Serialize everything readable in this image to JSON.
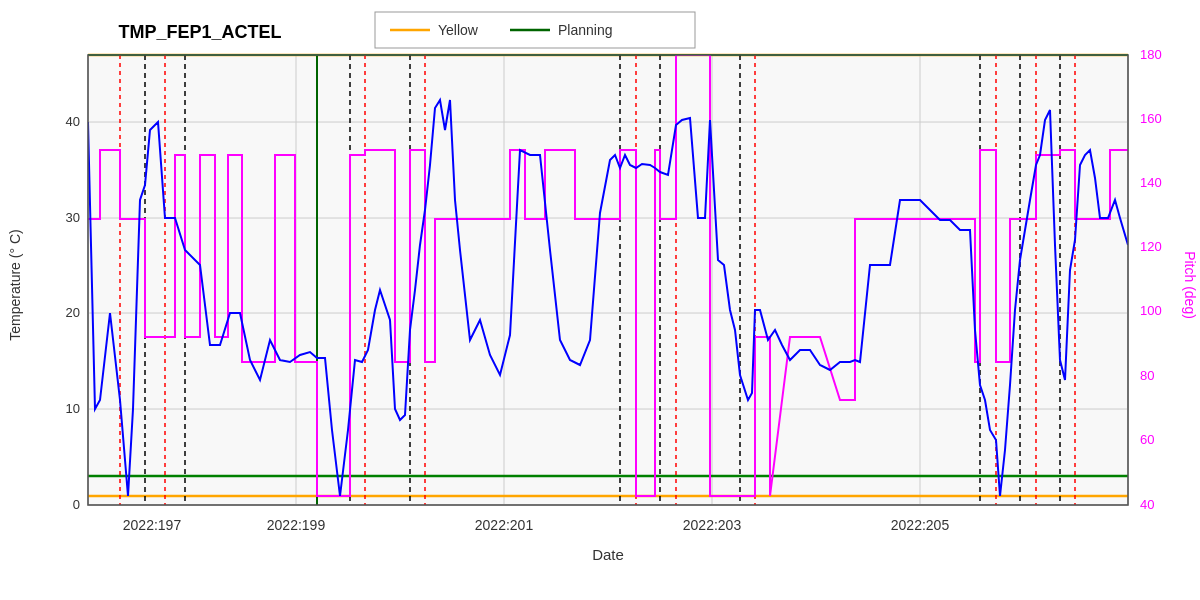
{
  "title": "TMP_FEP1_ACTEL",
  "legend": {
    "yellow_label": "Yellow",
    "planning_label": "Planning",
    "yellow_color": "#FFA500",
    "planning_color": "#006400"
  },
  "x_axis_label": "Date",
  "y_left_label": "Temperature (° C)",
  "y_right_label": "Pitch (deg)",
  "x_ticks": [
    "2022:197",
    "2022:199",
    "2022:201",
    "2022:203",
    "2022:205"
  ],
  "y_left_ticks": [
    0,
    10,
    20,
    30,
    40
  ],
  "y_right_ticks": [
    40,
    60,
    80,
    100,
    120,
    140,
    160,
    180
  ],
  "yellow_upper": 47,
  "yellow_lower": 1,
  "planning_upper": 47,
  "planning_lower": 3,
  "colors": {
    "blue": "#0000FF",
    "magenta": "#FF00FF",
    "yellow_line": "#FFA500",
    "green_line": "#006400",
    "red_dashed": "#FF0000",
    "black_dashed": "#000000",
    "grid": "#BBBBBB",
    "background": "#F8F8F8"
  }
}
